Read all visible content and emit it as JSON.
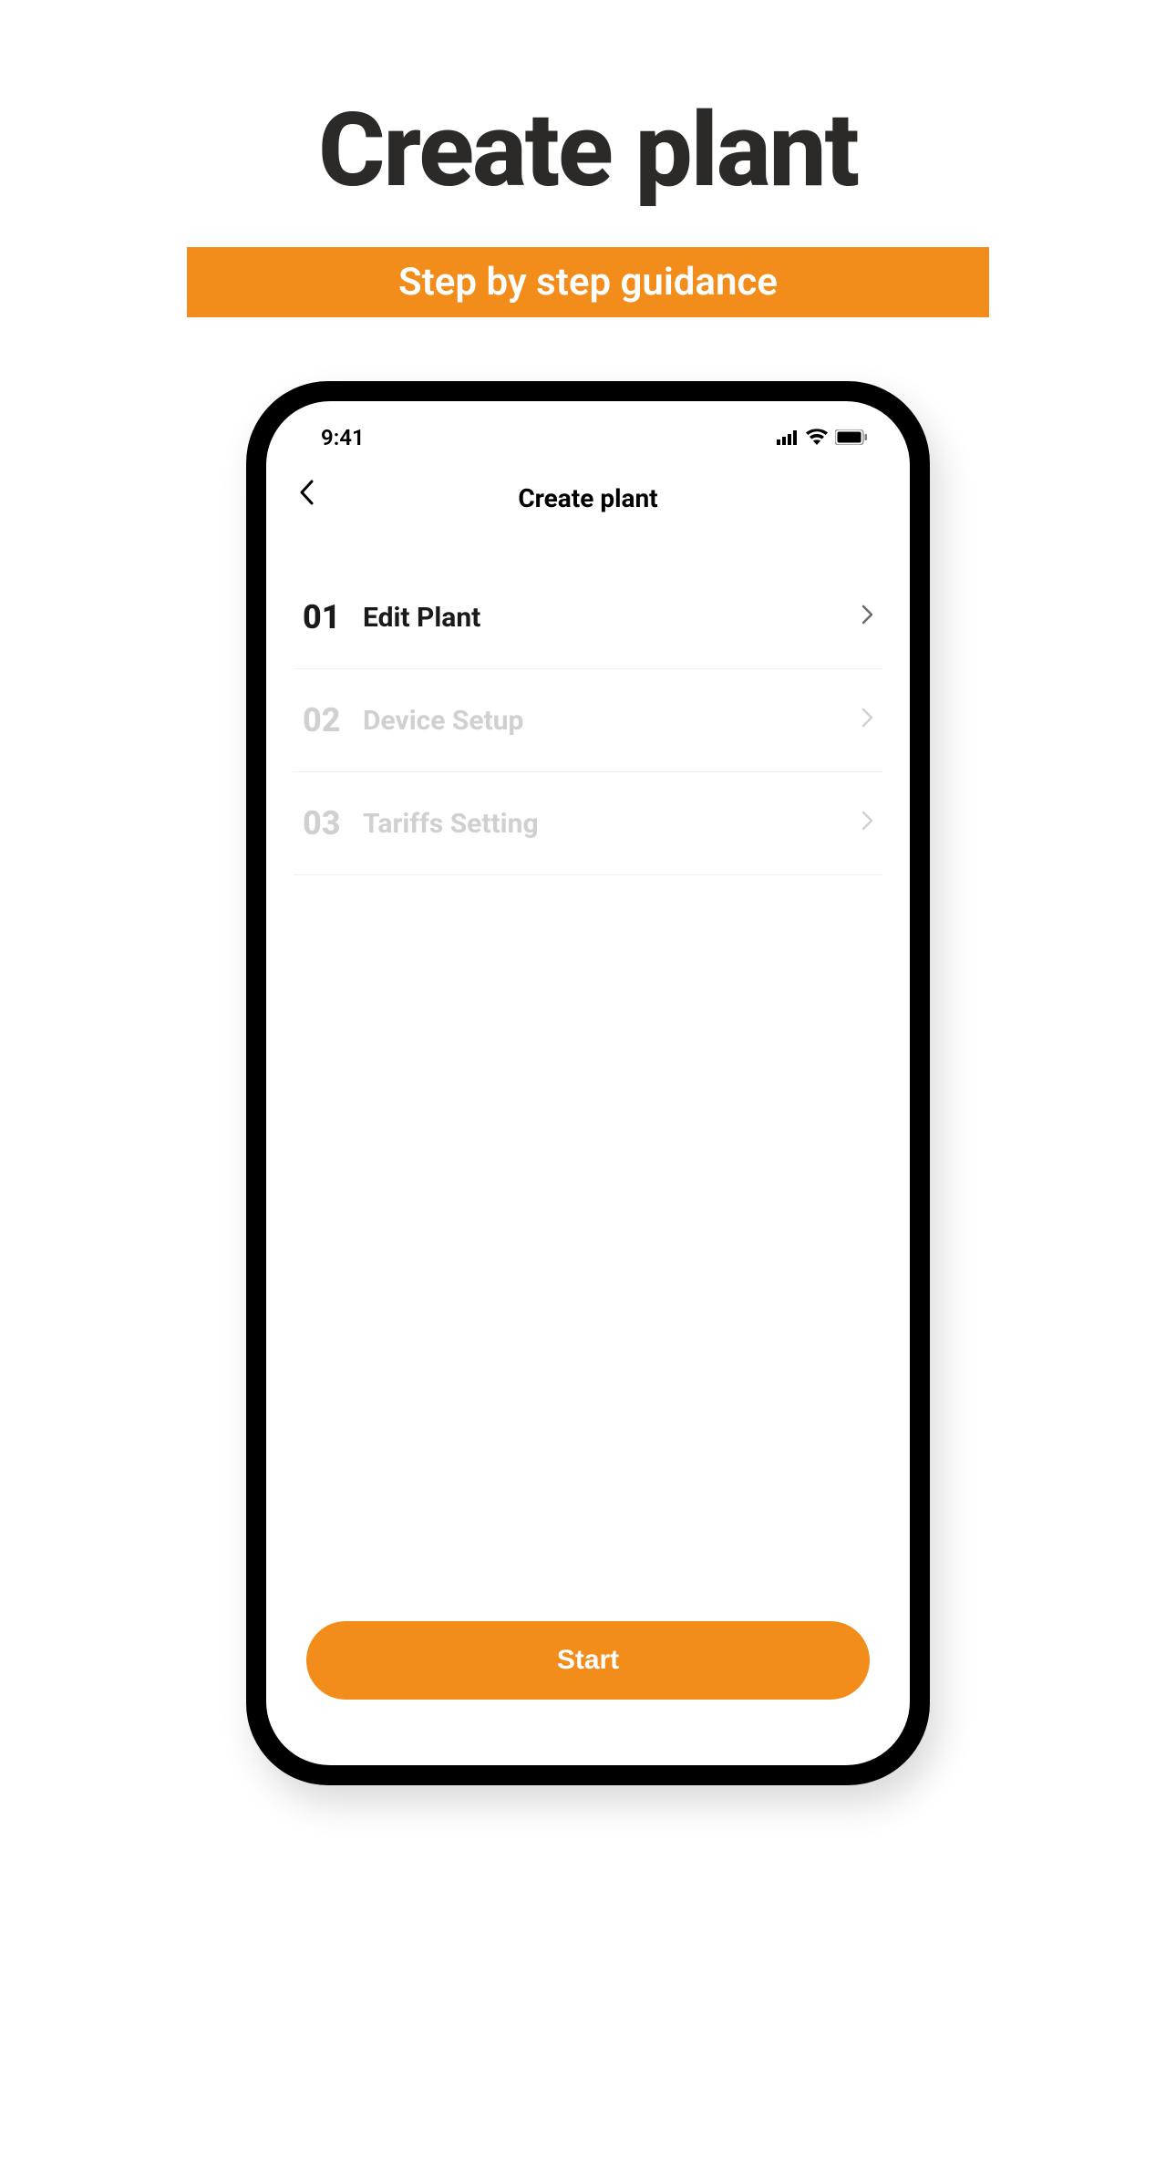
{
  "marketing": {
    "title": "Create plant",
    "subtitle": "Step by step guidance"
  },
  "statusBar": {
    "time": "9:41"
  },
  "nav": {
    "title": "Create plant"
  },
  "steps": [
    {
      "number": "01",
      "label": "Edit Plant",
      "active": true
    },
    {
      "number": "02",
      "label": "Device Setup",
      "active": false
    },
    {
      "number": "03",
      "label": "Tariffs Setting",
      "active": false
    }
  ],
  "button": {
    "start": "Start"
  },
  "colors": {
    "accent": "#f28c1b",
    "text_dark": "#2b2a28",
    "text_muted": "#d0d0d0"
  }
}
